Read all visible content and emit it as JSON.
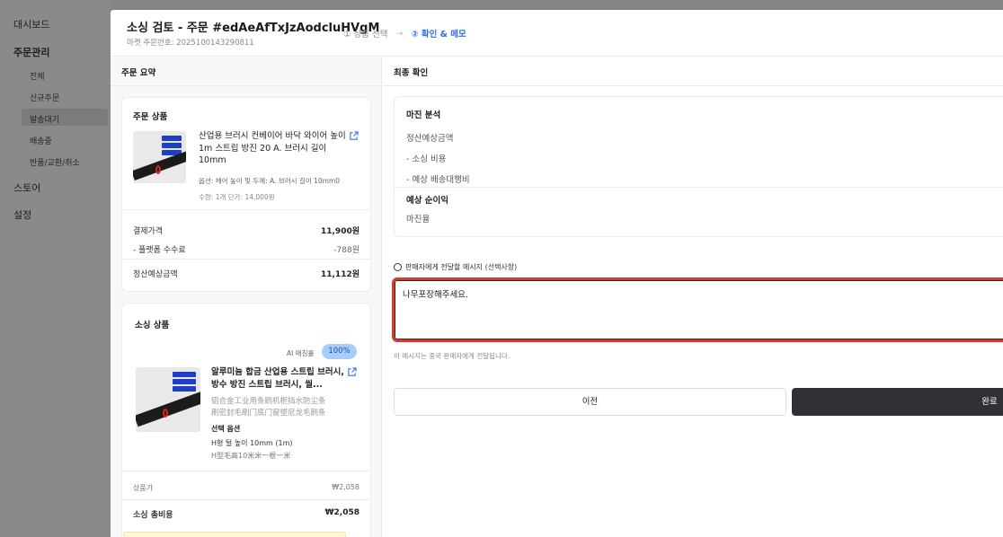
{
  "sidebar": {
    "dashboard": "대시보드",
    "orders": "주문관리",
    "sub": [
      "전체",
      "신규주문",
      "발송대기",
      "배송중",
      "반품/교환/취소"
    ],
    "store": "스토어",
    "settings": "설정"
  },
  "modal": {
    "title": "소싱 검토 - 주문 #edAeAfTxJzAodcluHVgM",
    "market_order_label": "마켓 주문번호: 2025100143290811",
    "step1": "① 상품 선택",
    "step2": "② 확인 & 메모"
  },
  "left": {
    "header": "주문 요약",
    "order_card": {
      "title": "주문 상품",
      "name": "산업용 브러시 컨베이어 바닥 와이어 높이 1m 스트립 방진 20 A. 브러시 길이 10mm",
      "option": "옵션: 헤어 높이 및 두께: A. 브러시 길이 10mm0",
      "meta": "수량: 1개    단가: 14,000원",
      "rows": [
        {
          "label": "결제가격",
          "value": "11,900원"
        },
        {
          "label": "- 플랫폼 수수료",
          "value": "-788원"
        },
        {
          "label": "정산예상금액",
          "value": "11,112원"
        }
      ]
    },
    "sourcing_card": {
      "title": "소싱 상품",
      "ai_label": "AI 매칭률",
      "ai_value": "100%",
      "name": "알루미늄 합금 산업용 스트립 브러시, 방수 방진 스트립 브러시, 씰...",
      "cn1": "铝合金工业用条刷机柜挡水防尘条",
      "cn2": "刷密封毛刷门底门窗塑尼龙毛刷条",
      "option_title": "선택 옵션",
      "option_value": "H형 털 높이 10mm (1m)",
      "option_cn": "H型毛高10米米一根一米",
      "price_label": "상품가",
      "price_value": "₩2,058",
      "total_label": "소싱 총비용",
      "total_value": "₩2,058"
    }
  },
  "right": {
    "header": "최종 확인",
    "margin": {
      "title": "마진 분석",
      "r1": "정산예상금액",
      "r2": "- 소싱 비용",
      "r3": "- 예상 배송대행비",
      "profit": "예상 순이익",
      "rate": "마진율"
    },
    "message_label": "판매자에게 전달할 메시지 (선택사항)",
    "message_value": "나무포장해주세요.",
    "message_note": "이 메시지는 중국 판매자에게 전달됩니다.",
    "prev": "이전",
    "done": "완료"
  },
  "colors": {
    "accent": "#2f6fde",
    "highlight": "#d9382c",
    "dark_button": "#2f3136"
  }
}
